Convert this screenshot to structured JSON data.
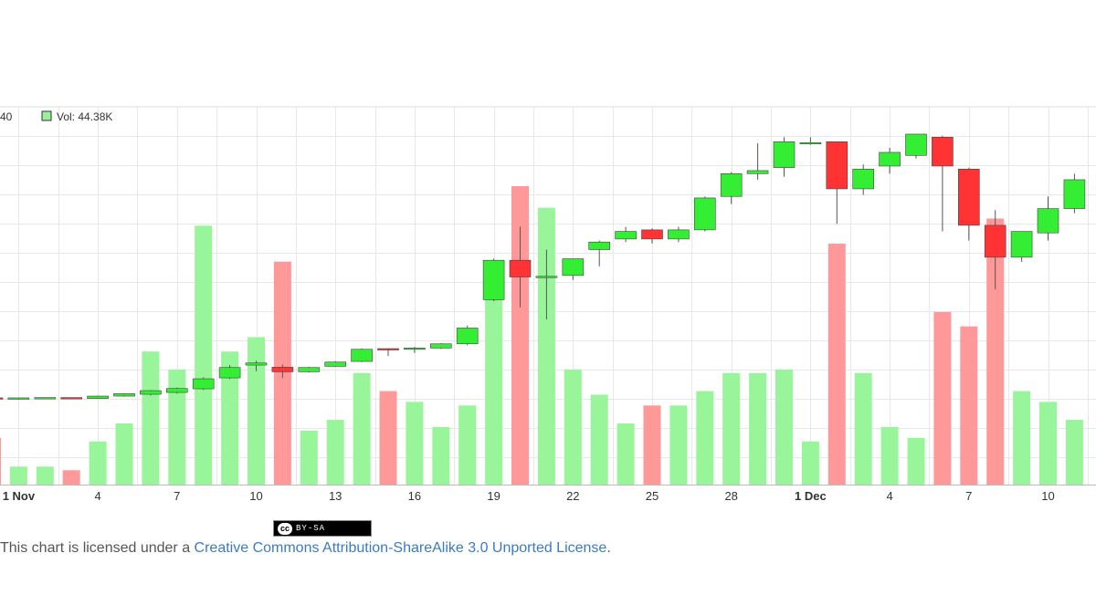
{
  "legend": {
    "clipped_value": "40",
    "volume_label": "Vol: 44.38K",
    "volume_swatch_color": "#99f099"
  },
  "colors": {
    "up_candle": "#33ee33",
    "down_candle": "#ff3333",
    "up_volume": "#99f599",
    "down_volume": "#ff9999",
    "grid": "#e8e8e8",
    "link": "#3c7bbf"
  },
  "license": {
    "badge_cc": "cc",
    "badge_text": "BY-SA",
    "prefix": "This chart is licensed under a ",
    "link_text": "Creative Commons Attribution-ShareAlike 3.0 Unported License",
    "suffix": "."
  },
  "chart_data": {
    "type": "candlestick",
    "title": "",
    "xlabel": "",
    "ylabel": "",
    "grid": true,
    "legend_placement": "top-left",
    "x_ticks": [
      {
        "label": "1 Nov",
        "bold": true,
        "day": 1
      },
      {
        "label": "4",
        "bold": false,
        "day": 4
      },
      {
        "label": "7",
        "bold": false,
        "day": 7
      },
      {
        "label": "10",
        "bold": false,
        "day": 10
      },
      {
        "label": "13",
        "bold": false,
        "day": 13
      },
      {
        "label": "16",
        "bold": false,
        "day": 16
      },
      {
        "label": "19",
        "bold": false,
        "day": 19
      },
      {
        "label": "22",
        "bold": false,
        "day": 22
      },
      {
        "label": "25",
        "bold": false,
        "day": 25
      },
      {
        "label": "28",
        "bold": false,
        "day": 28
      },
      {
        "label": "1 Dec",
        "bold": true,
        "day": 31
      },
      {
        "label": "4",
        "bold": false,
        "day": 34
      },
      {
        "label": "7",
        "bold": false,
        "day": 37
      },
      {
        "label": "10",
        "bold": false,
        "day": 40
      }
    ],
    "price_range": [
      0,
      100
    ],
    "volume_range": [
      0,
      100
    ],
    "candles": [
      {
        "day": 0,
        "open": 10.0,
        "high": 10.4,
        "low": 9.6,
        "close": 9.8,
        "volume": 13
      },
      {
        "day": 1,
        "open": 9.8,
        "high": 10.2,
        "low": 9.6,
        "close": 10.0,
        "volume": 5
      },
      {
        "day": 2,
        "open": 10.0,
        "high": 10.3,
        "low": 9.8,
        "close": 10.1,
        "volume": 5
      },
      {
        "day": 3,
        "open": 10.1,
        "high": 10.3,
        "low": 9.9,
        "close": 10.0,
        "volume": 4
      },
      {
        "day": 4,
        "open": 10.0,
        "high": 11.0,
        "low": 9.9,
        "close": 10.8,
        "volume": 12
      },
      {
        "day": 5,
        "open": 10.8,
        "high": 11.8,
        "low": 10.6,
        "close": 11.6,
        "volume": 17
      },
      {
        "day": 6,
        "open": 11.4,
        "high": 12.8,
        "low": 11.0,
        "close": 12.6,
        "volume": 37
      },
      {
        "day": 7,
        "open": 12.0,
        "high": 13.6,
        "low": 11.6,
        "close": 13.3,
        "volume": 32
      },
      {
        "day": 8,
        "open": 13.2,
        "high": 17.0,
        "low": 12.8,
        "close": 16.5,
        "volume": 72
      },
      {
        "day": 9,
        "open": 16.8,
        "high": 21.0,
        "low": 16.4,
        "close": 20.2,
        "volume": 37
      },
      {
        "day": 10,
        "open": 21.0,
        "high": 22.4,
        "low": 19.0,
        "close": 21.7,
        "volume": 41
      },
      {
        "day": 11,
        "open": 20.3,
        "high": 21.2,
        "low": 16.8,
        "close": 18.8,
        "volume": 62
      },
      {
        "day": 12,
        "open": 18.8,
        "high": 20.4,
        "low": 18.6,
        "close": 20.2,
        "volume": 15
      },
      {
        "day": 13,
        "open": 20.6,
        "high": 22.3,
        "low": 20.4,
        "close": 22.0,
        "volume": 18
      },
      {
        "day": 14,
        "open": 22.2,
        "high": 26.5,
        "low": 22.0,
        "close": 26.2,
        "volume": 31
      },
      {
        "day": 15,
        "open": 26.2,
        "high": 26.5,
        "low": 24.0,
        "close": 26.0,
        "volume": 26
      },
      {
        "day": 16,
        "open": 26.0,
        "high": 27.0,
        "low": 25.0,
        "close": 26.4,
        "volume": 23
      },
      {
        "day": 17,
        "open": 26.6,
        "high": 28.2,
        "low": 26.3,
        "close": 28.0,
        "volume": 16
      },
      {
        "day": 18,
        "open": 28.0,
        "high": 34.0,
        "low": 27.5,
        "close": 33.2,
        "volume": 22
      },
      {
        "day": 19,
        "open": 42.5,
        "high": 56.0,
        "low": 42.0,
        "close": 55.5,
        "volume": 61
      },
      {
        "day": 20,
        "open": 55.5,
        "high": 66.5,
        "low": 40.0,
        "close": 50.0,
        "volume": 83
      },
      {
        "day": 21,
        "open": 50.0,
        "high": 59.0,
        "low": 36.0,
        "close": 50.0,
        "volume": 77
      },
      {
        "day": 22,
        "open": 50.5,
        "high": 56.0,
        "low": 49.0,
        "close": 56.0,
        "volume": 32
      },
      {
        "day": 23,
        "open": 59.0,
        "high": 62.0,
        "low": 53.5,
        "close": 61.5,
        "volume": 25
      },
      {
        "day": 24,
        "open": 62.5,
        "high": 66.5,
        "low": 61.5,
        "close": 65.0,
        "volume": 17
      },
      {
        "day": 25,
        "open": 65.5,
        "high": 66.0,
        "low": 61.0,
        "close": 62.5,
        "volume": 22
      },
      {
        "day": 26,
        "open": 62.5,
        "high": 66.5,
        "low": 61.5,
        "close": 65.5,
        "volume": 22
      },
      {
        "day": 27,
        "open": 65.5,
        "high": 76.5,
        "low": 65.0,
        "close": 76.0,
        "volume": 26
      },
      {
        "day": 28,
        "open": 76.5,
        "high": 84.5,
        "low": 74.0,
        "close": 84.0,
        "volume": 31
      },
      {
        "day": 29,
        "open": 84.0,
        "high": 94.0,
        "low": 82.0,
        "close": 85.0,
        "volume": 31
      },
      {
        "day": 30,
        "open": 86.0,
        "high": 96.0,
        "low": 83.0,
        "close": 94.5,
        "volume": 32
      },
      {
        "day": 31,
        "open": 94.0,
        "high": 96.0,
        "low": 93.5,
        "close": 94.0,
        "volume": 12
      },
      {
        "day": 32,
        "open": 94.5,
        "high": 94.5,
        "low": 67.5,
        "close": 79.0,
        "volume": 67
      },
      {
        "day": 33,
        "open": 79.0,
        "high": 87.0,
        "low": 77.0,
        "close": 85.5,
        "volume": 31
      },
      {
        "day": 34,
        "open": 86.5,
        "high": 92.5,
        "low": 84.0,
        "close": 91.0,
        "volume": 16
      },
      {
        "day": 35,
        "open": 90.0,
        "high": 97.0,
        "low": 89.0,
        "close": 97.0,
        "volume": 13
      },
      {
        "day": 36,
        "open": 96.0,
        "high": 96.5,
        "low": 65.0,
        "close": 86.5,
        "volume": 48
      },
      {
        "day": 37,
        "open": 85.5,
        "high": 86.0,
        "low": 62.0,
        "close": 67.0,
        "volume": 44
      },
      {
        "day": 38,
        "open": 67.0,
        "high": 72.0,
        "low": 46.0,
        "close": 56.5,
        "volume": 74
      },
      {
        "day": 39,
        "open": 56.5,
        "high": 65.0,
        "low": 55.0,
        "close": 65.0,
        "volume": 26
      },
      {
        "day": 40,
        "open": 64.5,
        "high": 76.5,
        "low": 62.0,
        "close": 72.5,
        "volume": 23
      },
      {
        "day": 41,
        "open": 72.5,
        "high": 84.0,
        "low": 71.0,
        "close": 82.0,
        "volume": 18
      }
    ]
  }
}
